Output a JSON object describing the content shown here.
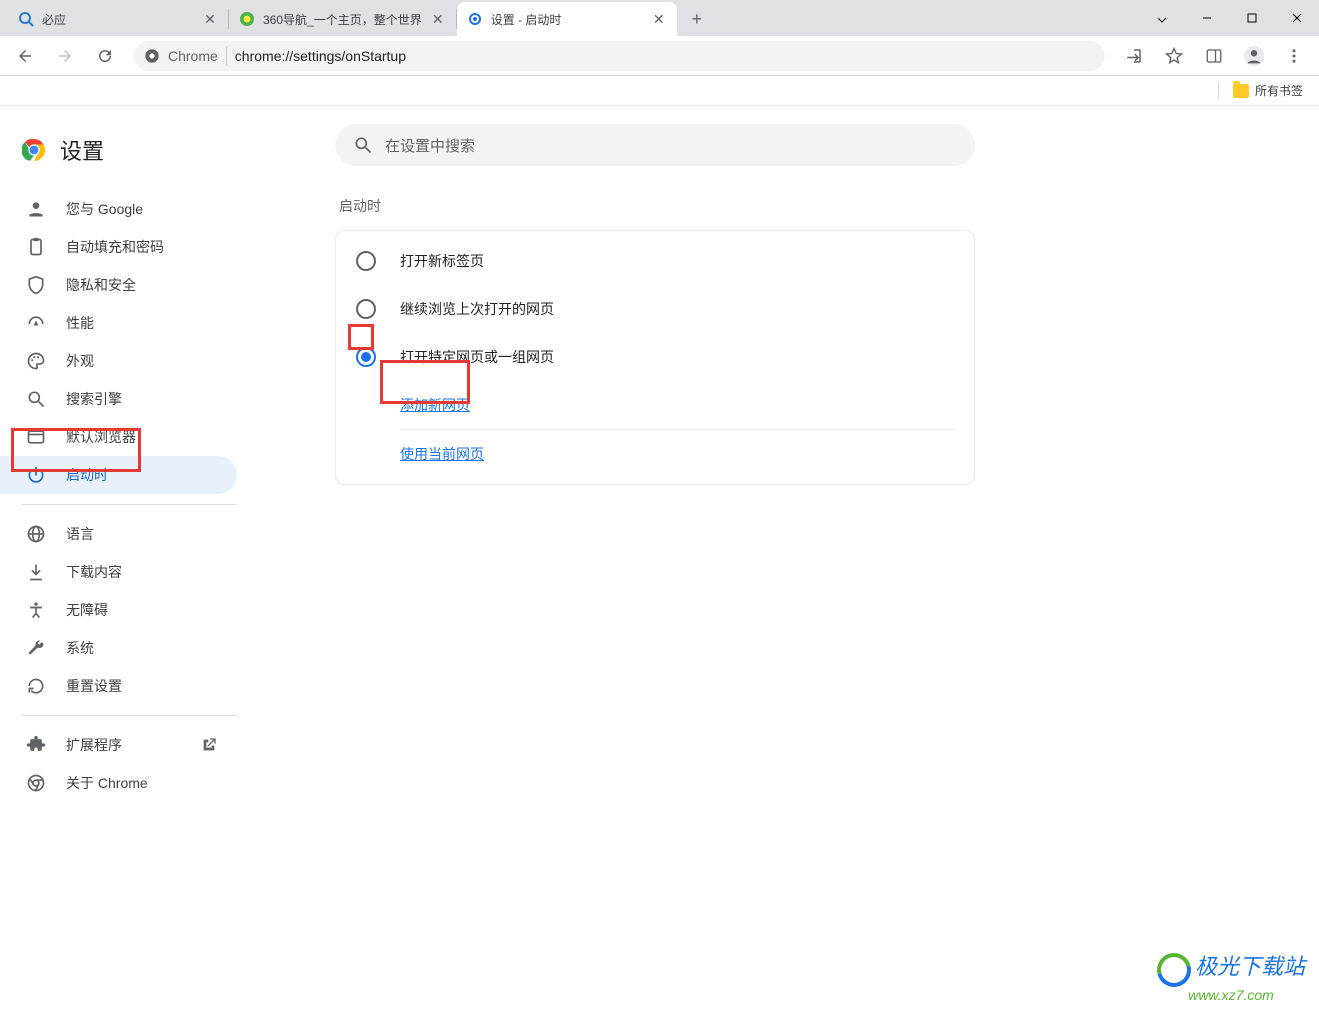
{
  "window": {
    "tabs": [
      {
        "title": "必应",
        "favicon": "bing"
      },
      {
        "title": "360导航_一个主页，整个世界",
        "favicon": "360"
      },
      {
        "title": "设置 - 启动时",
        "favicon": "settings",
        "active": true
      }
    ]
  },
  "url_bar": {
    "scheme_label": "Chrome",
    "url": "chrome://settings/onStartup"
  },
  "bookmarks_bar": {
    "all_bookmarks": "所有书签"
  },
  "settings": {
    "title": "设置",
    "search_placeholder": "在设置中搜索",
    "menu": [
      {
        "icon": "person",
        "label": "您与 Google"
      },
      {
        "icon": "clipboard",
        "label": "自动填充和密码"
      },
      {
        "icon": "shield",
        "label": "隐私和安全"
      },
      {
        "icon": "speed",
        "label": "性能"
      },
      {
        "icon": "palette",
        "label": "外观"
      },
      {
        "icon": "search",
        "label": "搜索引擎"
      },
      {
        "icon": "browser",
        "label": "默认浏览器"
      },
      {
        "icon": "power",
        "label": "启动时",
        "selected": true
      }
    ],
    "menu2": [
      {
        "icon": "globe",
        "label": "语言"
      },
      {
        "icon": "download",
        "label": "下载内容"
      },
      {
        "icon": "accessibility",
        "label": "无障碍"
      },
      {
        "icon": "wrench",
        "label": "系统"
      },
      {
        "icon": "reset",
        "label": "重置设置"
      }
    ],
    "menu3": [
      {
        "icon": "puzzle",
        "label": "扩展程序",
        "external": true
      },
      {
        "icon": "chrome",
        "label": "关于 Chrome"
      }
    ]
  },
  "startup": {
    "section_title": "启动时",
    "options": [
      {
        "label": "打开新标签页",
        "checked": false
      },
      {
        "label": "继续浏览上次打开的网页",
        "checked": false
      },
      {
        "label": "打开特定网页或一组网页",
        "checked": true
      }
    ],
    "add_page_link": "添加新网页",
    "use_current_link": "使用当前网页"
  },
  "watermark": {
    "line1": "极光下载站",
    "line2": "www.xz7.com"
  }
}
